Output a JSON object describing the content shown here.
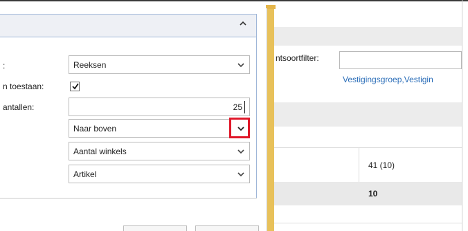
{
  "panel": {
    "collapse_icon": "chevron-up-icon",
    "fields": [
      {
        "label": ":",
        "value": "Reeksen"
      },
      {
        "label": "n toestaan:"
      },
      {
        "label": "antallen:",
        "value": "25"
      },
      {
        "value": "Naar boven"
      },
      {
        "value": "Aantal winkels"
      },
      {
        "value": "Artikel"
      }
    ],
    "checkbox_checked": true
  },
  "background": {
    "filter_label": "ntsoortfilter:",
    "link_text": "Vestigingsgroep,Vestigin",
    "cell_1": "41 (10)",
    "cell_2": "10"
  },
  "colors": {
    "accent_gold": "#e8c15a",
    "link": "#2a6db8",
    "highlight": "#e0182a",
    "panel_header": "#eef0f5"
  }
}
